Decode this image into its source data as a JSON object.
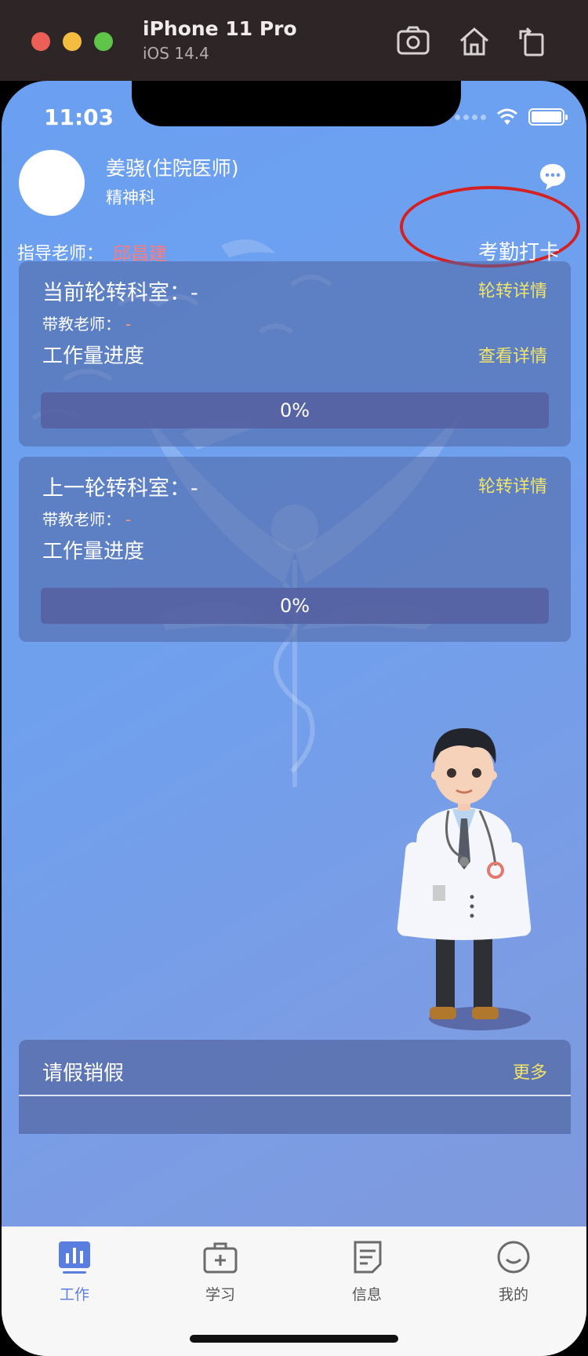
{
  "simulator": {
    "device": "iPhone 11 Pro",
    "os": "iOS 14.4"
  },
  "status_bar": {
    "time": "11:03"
  },
  "profile": {
    "name": "姜骁(住院医师)",
    "department": "精神科",
    "mentor_label": "指导老师：",
    "mentor_name": "邱昌建",
    "checkin_label": "考勤打卡"
  },
  "current_rotation": {
    "title": "当前轮转科室：-",
    "detail_link": "轮转详情",
    "teacher_label": "带教老师：",
    "teacher_value": "-",
    "workload_label": "工作量进度",
    "workload_link": "查看详情",
    "progress": 0,
    "progress_text": "0%"
  },
  "previous_rotation": {
    "title": "上一轮转科室：-",
    "detail_link": "轮转详情",
    "teacher_label": "带教老师：",
    "teacher_value": "-",
    "workload_label": "工作量进度",
    "progress": 0,
    "progress_text": "0%"
  },
  "leave": {
    "title": "请假销假",
    "more": "更多"
  },
  "tabs": [
    {
      "label": "工作",
      "icon": "chart-icon",
      "active": true
    },
    {
      "label": "学习",
      "icon": "medkit-icon",
      "active": false
    },
    {
      "label": "信息",
      "icon": "message-icon",
      "active": false
    },
    {
      "label": "我的",
      "icon": "smile-icon",
      "active": false
    }
  ],
  "colors": {
    "accent_link": "#f0e46a",
    "mentor_name": "#ff7a7a",
    "tab_active": "#5a7de0",
    "annotation_ring": "#d42020"
  }
}
